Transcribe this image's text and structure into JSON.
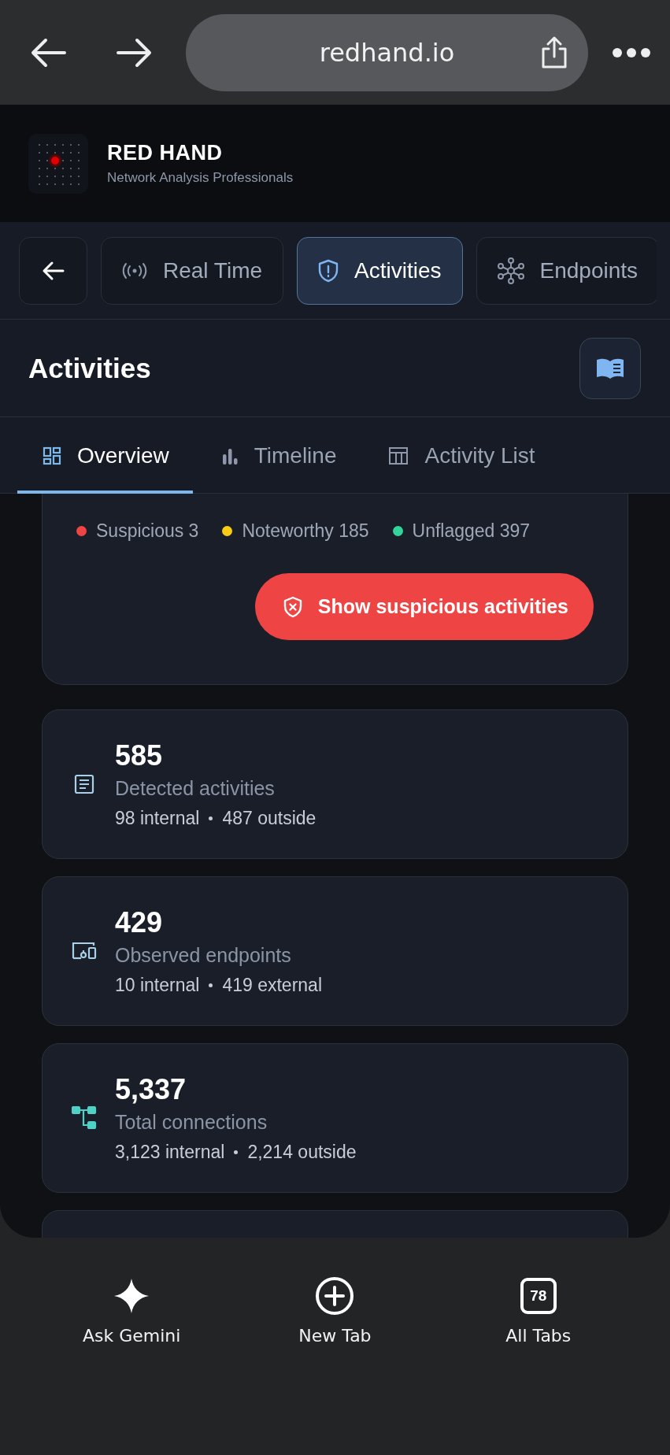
{
  "browser": {
    "url": "redhand.io"
  },
  "brand": {
    "name": "RED HAND",
    "tagline": "Network Analysis Professionals"
  },
  "nav_tabs": [
    {
      "label": "Real Time",
      "kind": "broadcast",
      "selected": false
    },
    {
      "label": "Activities",
      "kind": "shield",
      "selected": true
    },
    {
      "label": "Endpoints",
      "kind": "network",
      "selected": false
    }
  ],
  "page": {
    "title": "Activities"
  },
  "sub_tabs": [
    {
      "label": "Overview",
      "kind": "grid",
      "selected": true
    },
    {
      "label": "Timeline",
      "kind": "bars",
      "selected": false
    },
    {
      "label": "Activity List",
      "kind": "table",
      "selected": false
    }
  ],
  "summary": {
    "legend": [
      {
        "label": "Suspicious 3",
        "color": "#ef4444"
      },
      {
        "label": "Noteworthy 185",
        "color": "#facc15"
      },
      {
        "label": "Unflagged 397",
        "color": "#34d399"
      }
    ],
    "action": "Show suspicious activities"
  },
  "stats": [
    {
      "kind": "document",
      "value": "585",
      "label": "Detected activities",
      "breakdown": [
        "98 internal",
        "487 outside"
      ]
    },
    {
      "kind": "devices",
      "value": "429",
      "label": "Observed endpoints",
      "breakdown": [
        "10 internal",
        "419 external"
      ]
    },
    {
      "kind": "tree",
      "value": "5,337",
      "label": "Total connections",
      "breakdown": [
        "3,123 internal",
        "2,214 outside"
      ]
    }
  ],
  "toolbar": [
    {
      "kind": "sparkle",
      "label": "Ask Gemini"
    },
    {
      "kind": "plus",
      "label": "New Tab"
    },
    {
      "kind": "tabs",
      "label": "All Tabs",
      "count": "78"
    }
  ]
}
